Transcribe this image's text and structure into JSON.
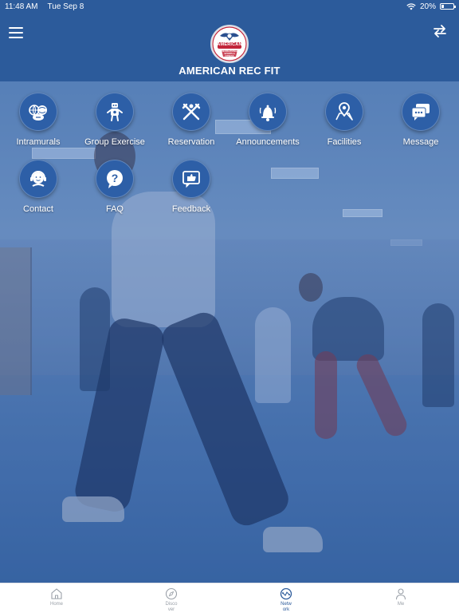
{
  "status_bar": {
    "time": "11:48 AM",
    "date": "Tue Sep 8",
    "battery_percent": "20%",
    "battery_level": 0.2
  },
  "header": {
    "title": "AMERICAN REC FIT",
    "logo_text": "AMERICAN",
    "logo_subtext": "RECREATIONAL SPORTS & FITNESS",
    "menu_icon": "hamburger-menu-icon",
    "switch_icon": "swap-arrows-icon"
  },
  "tiles": [
    {
      "label": "Intramurals",
      "icon": "sports-balls-icon"
    },
    {
      "label": "Group Exercise",
      "icon": "robot-fitness-icon"
    },
    {
      "label": "Reservation",
      "icon": "crossed-tools-icon"
    },
    {
      "label": "Announcements",
      "icon": "bell-icon"
    },
    {
      "label": "Facilities",
      "icon": "map-pin-icon"
    },
    {
      "label": "Message",
      "icon": "chat-bubbles-icon"
    },
    {
      "label": "Contact",
      "icon": "headset-person-icon"
    },
    {
      "label": "FAQ",
      "icon": "question-bubble-icon"
    },
    {
      "label": "Feedback",
      "icon": "thumbs-up-bubble-icon"
    }
  ],
  "tabbar": {
    "items": [
      {
        "label": "Home",
        "icon": "home-icon"
      },
      {
        "label": "Disco\nver",
        "icon": "compass-icon"
      },
      {
        "label": "Netw\nork",
        "icon": "network-icon"
      },
      {
        "label": "Me",
        "icon": "person-icon"
      }
    ],
    "active_index": 2
  },
  "colors": {
    "header_bg": "#2c5b9b",
    "tile_bg": "#2d5fa7",
    "active_tab": "#2c5b9b",
    "inactive_tab": "#9aa0a8"
  }
}
